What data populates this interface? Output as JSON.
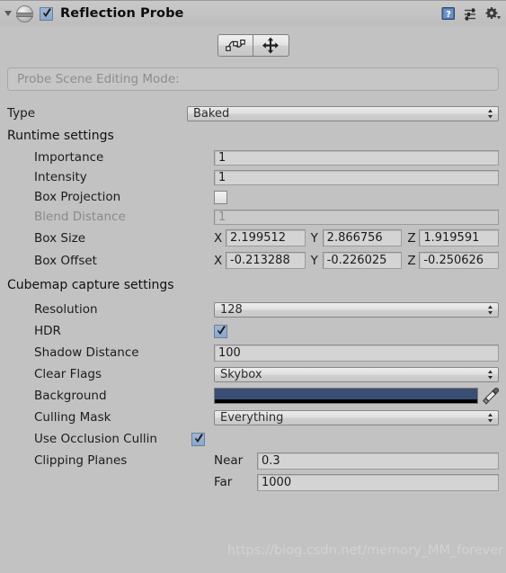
{
  "header": {
    "title": "Reflection Probe",
    "enabled_checkbox": true,
    "foldout_icon": "triangle-down-icon",
    "component_icon": "reflection-probe-icon",
    "help_icon": "help-book-icon",
    "preset_icon": "preset-sliders-icon",
    "settings_icon": "gear-dropdown-icon"
  },
  "toolbar": {
    "edit_bounds_icon": "edit-bounding-volume-icon",
    "move_origin_icon": "move-probe-origin-icon"
  },
  "scene_edit": {
    "placeholder": "Probe Scene Editing Mode:"
  },
  "type_row": {
    "label": "Type",
    "value": "Baked"
  },
  "runtime": {
    "section_title": "Runtime settings",
    "importance": {
      "label": "Importance",
      "value": "1"
    },
    "intensity": {
      "label": "Intensity",
      "value": "1"
    },
    "box_projection": {
      "label": "Box Projection",
      "checked": false
    },
    "blend_distance": {
      "label": "Blend Distance",
      "value": "1",
      "disabled": true
    },
    "box_size": {
      "label": "Box Size",
      "axes": [
        "X",
        "Y",
        "Z"
      ],
      "values": [
        "2.199512",
        "2.866756",
        "1.919591"
      ]
    },
    "box_offset": {
      "label": "Box Offset",
      "axes": [
        "X",
        "Y",
        "Z"
      ],
      "values": [
        "-0.213288",
        "-0.226025",
        "-0.250626"
      ]
    }
  },
  "cubemap": {
    "section_title": "Cubemap capture settings",
    "resolution": {
      "label": "Resolution",
      "value": "128"
    },
    "hdr": {
      "label": "HDR",
      "checked": true
    },
    "shadow_distance": {
      "label": "Shadow Distance",
      "value": "100"
    },
    "clear_flags": {
      "label": "Clear Flags",
      "value": "Skybox"
    },
    "background": {
      "label": "Background",
      "color": "#3a4d73",
      "alpha_color": "#000000",
      "eyedropper_icon": "eyedropper-icon"
    },
    "culling_mask": {
      "label": "Culling Mask",
      "value": "Everything"
    },
    "occlusion_culling": {
      "label": "Use Occlusion Cullin",
      "checked": true
    },
    "clipping_planes": {
      "label": "Clipping Planes",
      "near_label": "Near",
      "near_value": "0.3",
      "far_label": "Far",
      "far_value": "1000"
    }
  },
  "watermark": {
    "text": "https://blog.csdn.net/memory_MM_forever"
  }
}
